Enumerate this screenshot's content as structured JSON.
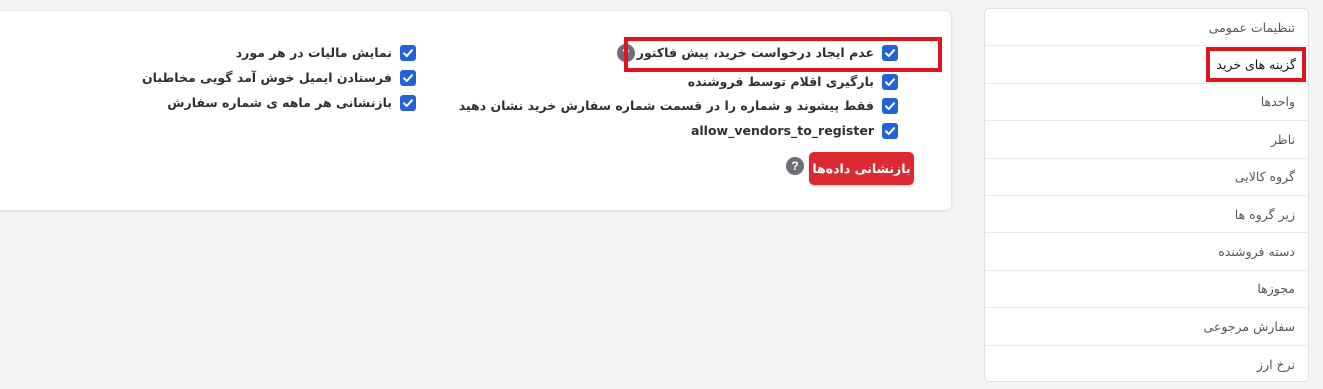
{
  "options_right": [
    {
      "label": "عدم ایجاد درخواست خرید، پیش فاکتور",
      "checked": true,
      "has_help": true,
      "highlighted": true
    },
    {
      "label": "بارگیری اقلام توسط فروشنده",
      "checked": true
    },
    {
      "label": "فقط پیشوند و شماره را در قسمت شماره سفارش خرید نشان دهید",
      "checked": true
    },
    {
      "label": "allow_vendors_to_register",
      "checked": true
    }
  ],
  "options_left": [
    {
      "label": "نمایش مالیات در هر مورد",
      "checked": true
    },
    {
      "label": "فرستادن ایمیل خوش آمد گویی مخاطبان",
      "checked": true
    },
    {
      "label": "بازنشانی هر ماهه ی شماره سفارش",
      "checked": true
    }
  ],
  "reset_button": {
    "label": "بازنشانی داده‌ها"
  },
  "help_glyph": "?",
  "sidebar": {
    "items": [
      {
        "label": "تنظیمات عمومی"
      },
      {
        "label": "گزینه های خرید",
        "active": true
      },
      {
        "label": "واحدها"
      },
      {
        "label": "ناظر"
      },
      {
        "label": "گروه کالایی"
      },
      {
        "label": "زیر گروه ها"
      },
      {
        "label": "دسته فروشنده"
      },
      {
        "label": "مجوزها"
      },
      {
        "label": "سفارش مرجوعی"
      },
      {
        "label": "نرخ ارز"
      }
    ]
  },
  "colors": {
    "checkbox": "#2463d6",
    "highlight": "#e0141d",
    "reset_button": "#dc2a32",
    "help_icon": "#6d6e78"
  },
  "icons": {
    "checkbox": "checkmark-icon",
    "help": "question-mark-icon"
  }
}
